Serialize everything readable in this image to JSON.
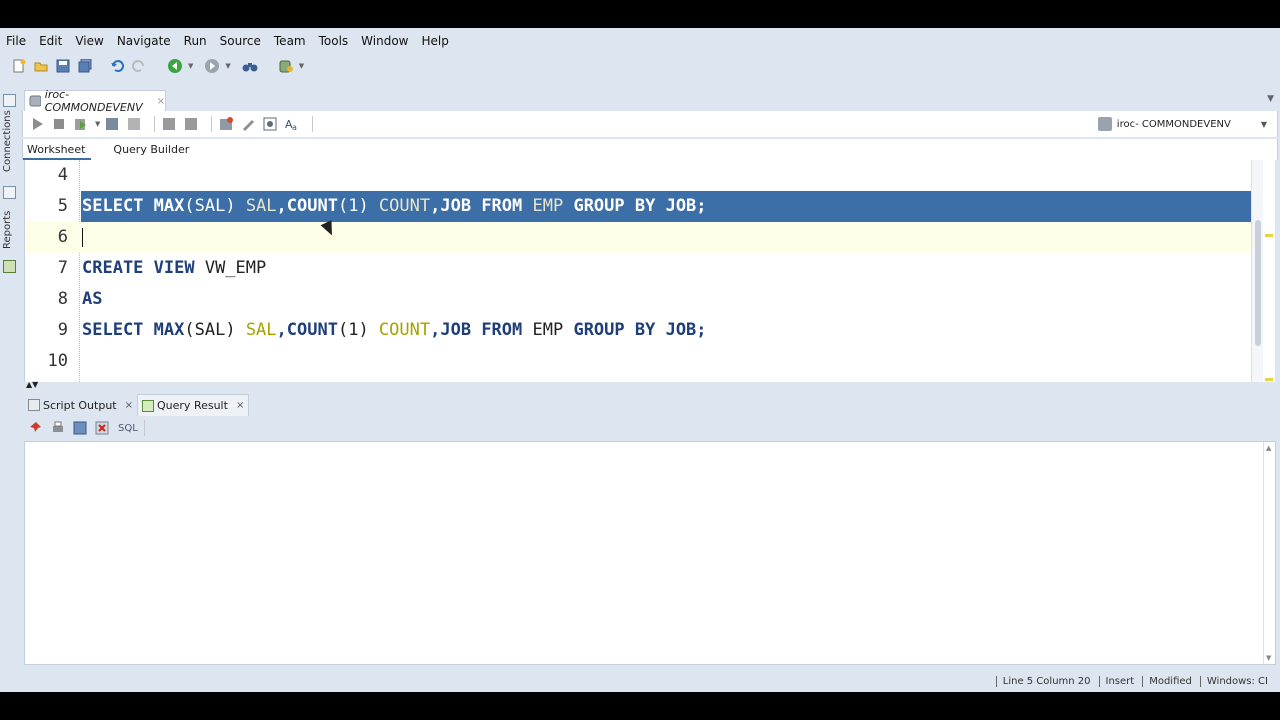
{
  "menu": [
    "File",
    "Edit",
    "View",
    "Navigate",
    "Run",
    "Source",
    "Team",
    "Tools",
    "Window",
    "Help"
  ],
  "side_tabs": {
    "connections": "Connections",
    "reports": "Reports"
  },
  "document_tab": {
    "title": "iroc- COMMONDEVENV",
    "close": "×"
  },
  "connection_select": {
    "value": "iroc- COMMONDEVENV"
  },
  "worksheet_tabs": {
    "worksheet": "Worksheet",
    "query_builder": "Query Builder"
  },
  "editor": {
    "line_numbers": [
      "4",
      "5",
      "6",
      "7",
      "8",
      "9",
      "10"
    ],
    "status": {
      "selected_line": "5",
      "current_line": "6"
    }
  },
  "code": {
    "l5": {
      "kw1": "SELECT",
      "fn1": "MAX",
      "p1": "(SAL) ",
      "a1": "SAL",
      "c1": ",",
      "fn2": "COUNT",
      "p2": "(1) ",
      "a2": "COUNT",
      "c2": ",",
      "k3": "JOB",
      "k4": " FROM ",
      "a3": "EMP",
      "k5": " GROUP BY ",
      "k6": "JOB;"
    },
    "l7": {
      "kw1": "CREATE VIEW",
      "rest": " VW_EMP"
    },
    "l8": {
      "kw1": "AS"
    },
    "l9": {
      "kw1": "SELECT",
      "fn1": "MAX",
      "p1": "(SAL) ",
      "a1": "SAL",
      "c1": ",",
      "fn2": "COUNT",
      "p2": "(1) ",
      "a2": "COUNT",
      "c2": ",",
      "k3": "JOB",
      "k4": " FROM ",
      "p3": "EMP",
      "k5": " GROUP BY ",
      "k6": "JOB;"
    }
  },
  "result_tabs": {
    "script_output": "Script Output",
    "query_result": "Query Result",
    "close": "×"
  },
  "result_toolbar": {
    "sql": "SQL"
  },
  "status_bar": {
    "position": "Line 5 Column 20",
    "mode": "Insert",
    "modified": "Modified",
    "encoding": "Windows: CI"
  },
  "colors": {
    "selection": "#3c6ea7",
    "keyword": "#1f3f7a",
    "alias": "#a6a300",
    "current_line": "#fffee8"
  }
}
